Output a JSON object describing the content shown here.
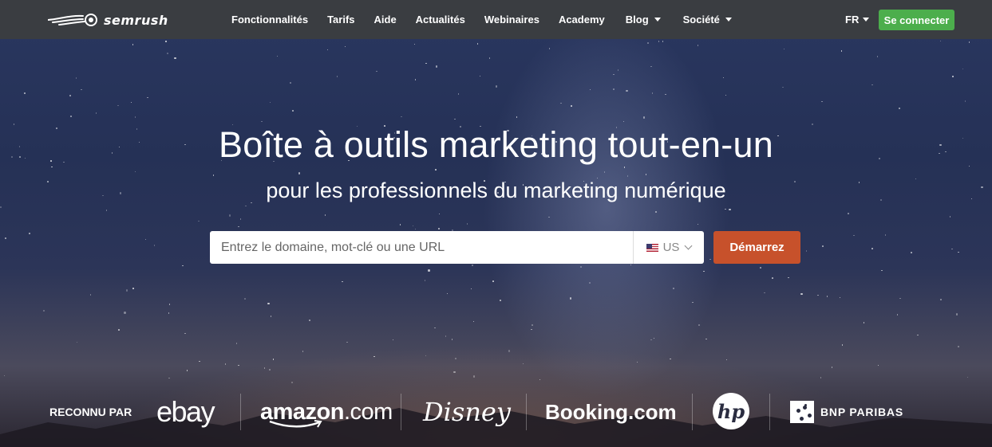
{
  "nav": {
    "logo_text": "semrush",
    "items": [
      {
        "label": "Fonctionnalités",
        "dropdown": false
      },
      {
        "label": "Tarifs",
        "dropdown": false
      },
      {
        "label": "Aide",
        "dropdown": false
      },
      {
        "label": "Actualités",
        "dropdown": false
      },
      {
        "label": "Webinaires",
        "dropdown": false
      },
      {
        "label": "Academy",
        "dropdown": false
      },
      {
        "label": "Blog",
        "dropdown": true
      },
      {
        "label": "Société",
        "dropdown": true
      }
    ],
    "language": "FR",
    "login_label": "Se connecter"
  },
  "hero": {
    "title": "Boîte à outils marketing tout-en-un",
    "subtitle": "pour les professionnels du marketing numérique"
  },
  "search": {
    "placeholder": "Entrez le domaine, mot-clé ou une URL",
    "value": "",
    "country": "US",
    "button_label": "Démarrez"
  },
  "trusted": {
    "label": "RECONNU PAR",
    "brands": [
      {
        "name": "ebay",
        "icon": "ebay-logo"
      },
      {
        "name": "amazon",
        "suffix": ".com",
        "icon": "amazon-logo"
      },
      {
        "name": "Disney",
        "icon": "disney-logo"
      },
      {
        "name": "Booking.com",
        "icon": "booking-logo"
      },
      {
        "name": "hp",
        "icon": "hp-logo"
      },
      {
        "name": "BNP PARIBAS",
        "icon": "bnp-paribas-logo"
      }
    ]
  },
  "colors": {
    "nav_bg": "#3a3d41",
    "login_green": "#4cae4c",
    "start_orange": "#c7512b"
  }
}
